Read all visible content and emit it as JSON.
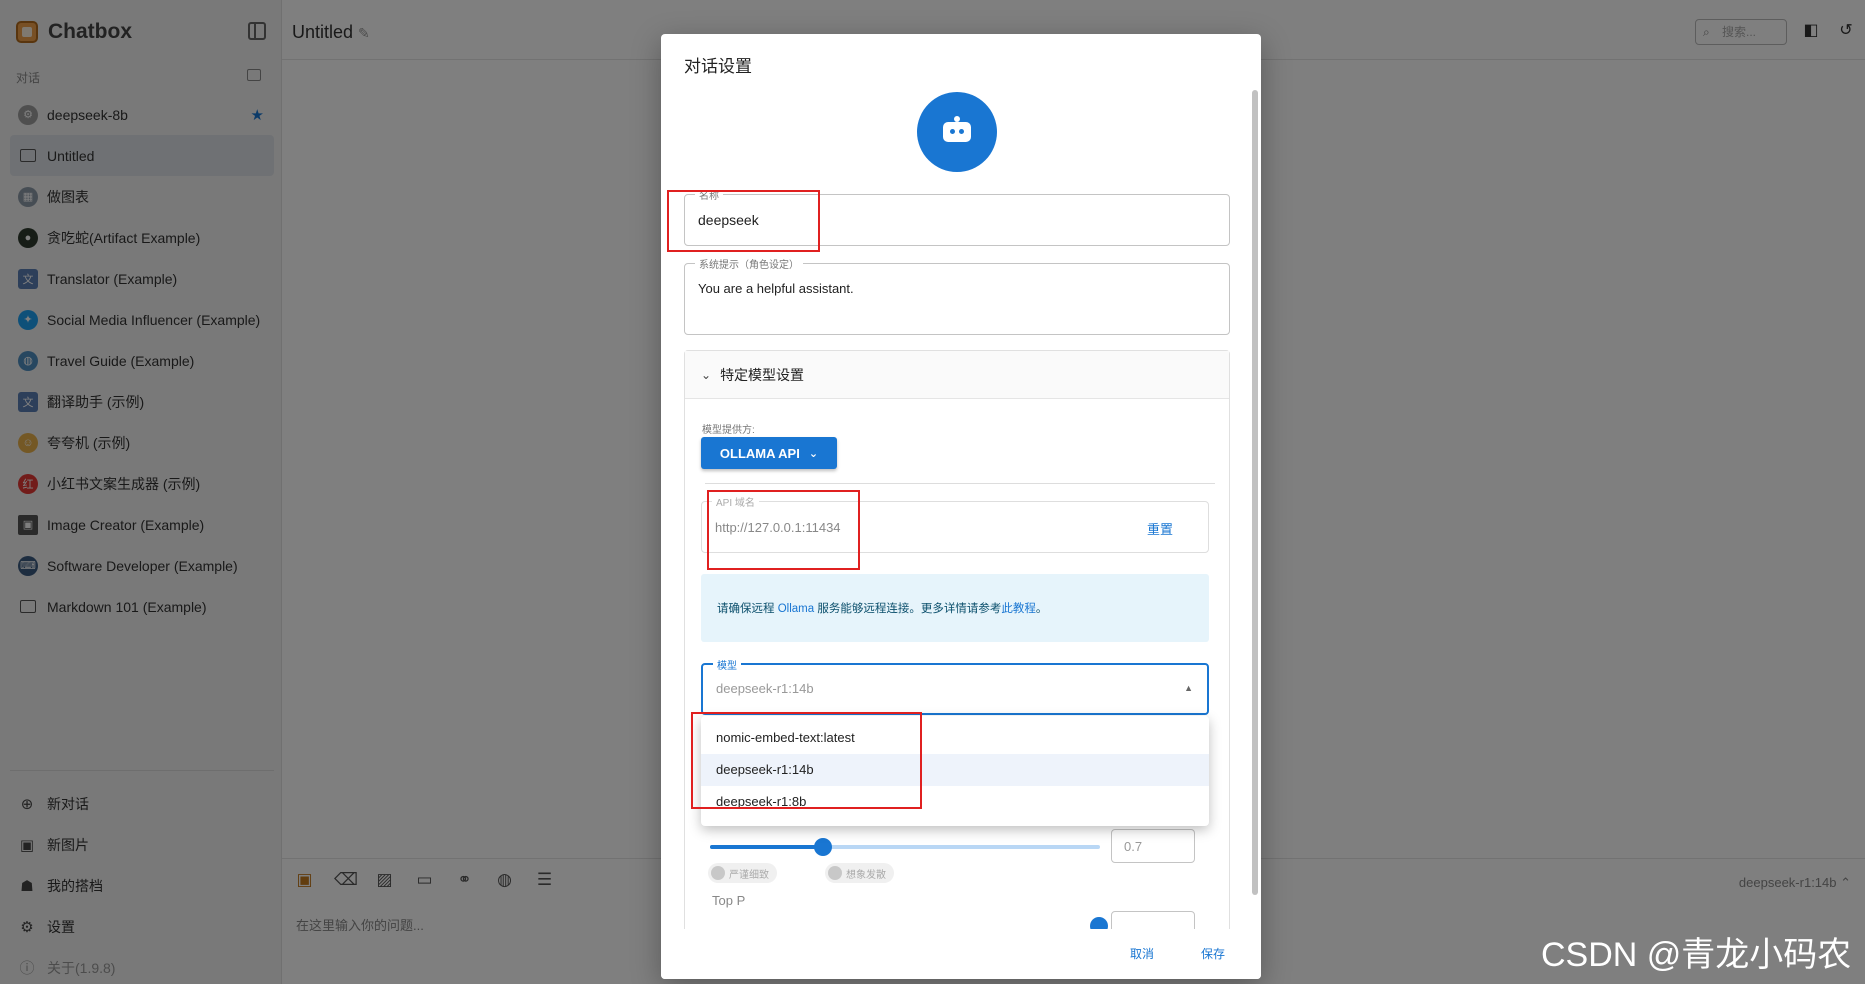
{
  "app": {
    "name": "Chatbox"
  },
  "sidebar": {
    "section_label": "对话",
    "conversations": [
      {
        "label": "deepseek-8b",
        "icon": "gear-avatar",
        "starred": true
      },
      {
        "label": "Untitled",
        "icon": "chat-bubble",
        "active": true
      },
      {
        "label": "做图表",
        "icon": "chart-avatar"
      },
      {
        "label": "贪吃蛇(Artifact Example)",
        "icon": "snake-avatar"
      },
      {
        "label": "Translator (Example)",
        "icon": "translator-avatar"
      },
      {
        "label": "Social Media Influencer (Example)",
        "icon": "twitter-avatar"
      },
      {
        "label": "Travel Guide (Example)",
        "icon": "globe-avatar"
      },
      {
        "label": "翻译助手 (示例)",
        "icon": "translator-avatar"
      },
      {
        "label": "夸夸机 (示例)",
        "icon": "praise-avatar"
      },
      {
        "label": "小红书文案生成器 (示例)",
        "icon": "xiaohongshu-avatar"
      },
      {
        "label": "Image Creator (Example)",
        "icon": "image-avatar"
      },
      {
        "label": "Software Developer (Example)",
        "icon": "developer-avatar"
      },
      {
        "label": "Markdown 101 (Example)",
        "icon": "chat-bubble"
      }
    ],
    "bottom": {
      "new_chat": "新对话",
      "new_image": "新图片",
      "my_copilots": "我的搭档",
      "settings": "设置",
      "about": "关于(1.9.8)"
    }
  },
  "topbar": {
    "title": "Untitled",
    "search_placeholder": "搜索..."
  },
  "composer": {
    "placeholder": "在这里输入你的问题...",
    "model": "deepseek-r1:14b ⌃"
  },
  "dialog": {
    "title": "对话设置",
    "name_label": "名称",
    "name_value": "deepseek",
    "system_prompt_label": "系统提示（角色设定）",
    "system_prompt_value": "You are a helpful assistant.",
    "model_settings_title": "特定模型设置",
    "provider_label": "模型提供方:",
    "provider_value": "OLLAMA API",
    "api_host_label": "API 域名",
    "api_host_value": "http://127.0.0.1:11434",
    "reset_label": "重置",
    "info_text_prefix": "请确保远程 ",
    "info_link_ollama": "Ollama",
    "info_text_middle": " 服务能够远程连接。更多详情请参考",
    "info_link_tutorial": "此教程",
    "info_text_suffix": "。",
    "model_label": "模型",
    "model_value": "deepseek-r1:14b",
    "model_options": [
      "nomic-embed-text:latest",
      "deepseek-r1:14b",
      "deepseek-r1:8b"
    ],
    "selected_option_index": 1,
    "temperature_value": "0.7",
    "temperature_fraction": 0.29,
    "chip_strict": "严谨细致",
    "chip_creative": "想象发散",
    "top_p_label": "Top P",
    "cancel_label": "取消",
    "save_label": "保存"
  },
  "watermark": "CSDN @青龙小码农",
  "colors": {
    "primary": "#1976d2",
    "highlight_box": "#e02020",
    "info_bg": "#e6f4fb"
  }
}
